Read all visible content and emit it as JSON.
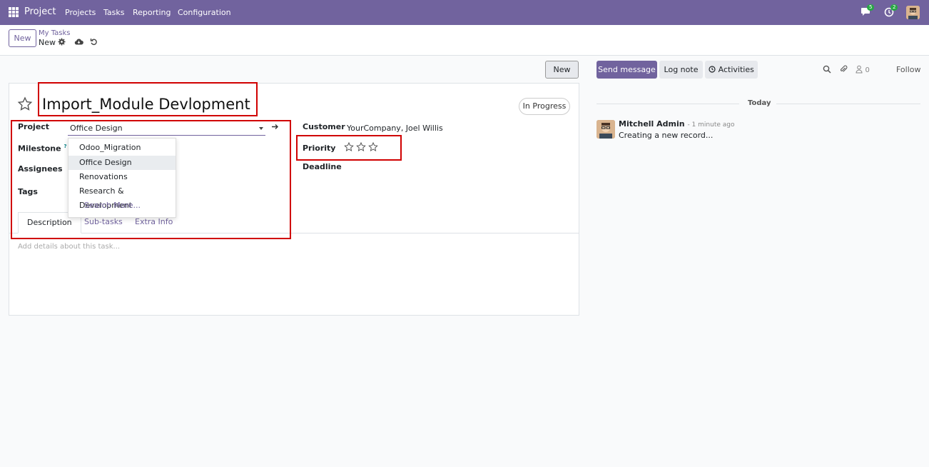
{
  "navbar": {
    "app_name": "Project",
    "menu": [
      "Projects",
      "Tasks",
      "Reporting",
      "Configuration"
    ],
    "messages_badge": "5",
    "activities_badge": "2",
    "bg_color": "#71639e"
  },
  "control_panel": {
    "new_label": "New",
    "breadcrumb": "My Tasks",
    "record_name": "New"
  },
  "form": {
    "new_label": "New",
    "title": "Import_Module Devlopment",
    "stage": "In Progress",
    "fields": {
      "project_label": "Project",
      "project_value": "Office Design",
      "milestone_label": "Milestone",
      "milestone_help": "?",
      "assignees_label": "Assignees",
      "tags_label": "Tags",
      "customer_label": "Customer",
      "customer_value": "YourCompany, Joel Willis",
      "priority_label": "Priority",
      "priority_stars": 0,
      "deadline_label": "Deadline"
    },
    "project_dropdown": {
      "options": [
        "Odoo_Migration",
        "Office Design",
        "Renovations",
        "Research & Development"
      ],
      "active_option": "Office Design",
      "search_more": "Search More..."
    },
    "tabs": [
      "Description",
      "Sub-tasks",
      "Extra Info"
    ],
    "active_tab": "Description",
    "description_placeholder": "Add details about this task..."
  },
  "chatter": {
    "send_message": "Send message",
    "log_note": "Log note",
    "activities": "Activities",
    "attachments_count": "0",
    "follow": "Follow",
    "today": "Today",
    "message": {
      "author": "Mitchell Admin",
      "time": "- 1 minute ago",
      "body": "Creating a new record..."
    }
  }
}
